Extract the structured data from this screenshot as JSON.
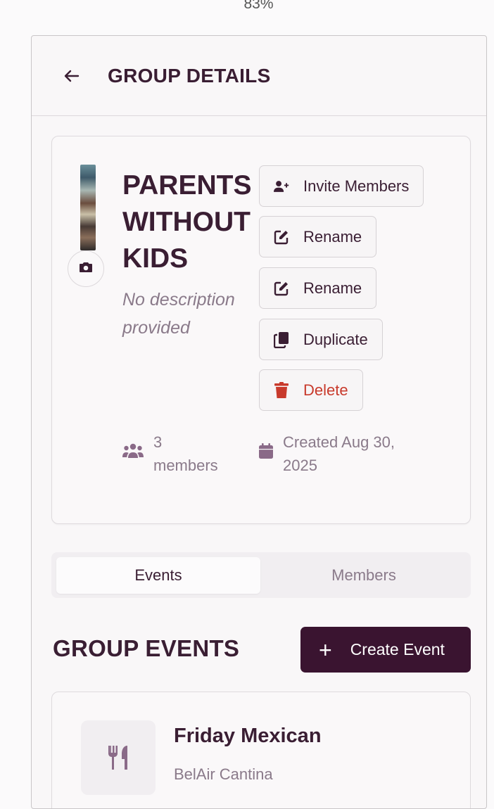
{
  "zoom": "83%",
  "header": {
    "title": "GROUP DETAILS"
  },
  "group": {
    "name": "PARENTS WITHOUT KIDS",
    "description": "No description provided",
    "members_count_text": "3",
    "members_label": "members",
    "created_text": "Created Aug 30, 2025"
  },
  "actions": {
    "invite": "Invite Members",
    "rename_1": "Rename",
    "rename_2": "Rename",
    "duplicate": "Duplicate",
    "delete": "Delete"
  },
  "tabs": [
    {
      "label": "Events",
      "active": true
    },
    {
      "label": "Members",
      "active": false
    }
  ],
  "events_section": {
    "title": "GROUP EVENTS",
    "create_label": "Create Event",
    "create_icon": "+"
  },
  "events": [
    {
      "title": "Friday Mexican",
      "venue": "BelAir Cantina",
      "icon": "utensils-icon"
    }
  ],
  "colors": {
    "primary": "#3a1430",
    "text": "#3a1e33",
    "muted": "#8a7a8a",
    "danger": "#c83a2c"
  }
}
